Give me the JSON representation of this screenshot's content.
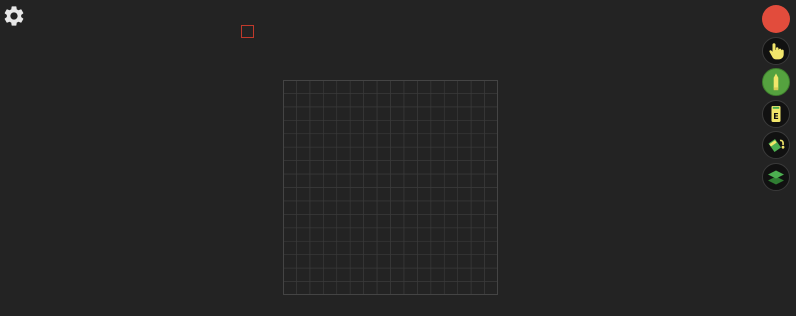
{
  "colors": {
    "background": "#232323",
    "grid_line": "#3a3a3a",
    "grid_border": "#444444",
    "selection_outline": "#c0392b",
    "current_color": "#e24c3c",
    "tool_bg": "#111111",
    "tool_active_bg": "#55a23f",
    "icon_fill": "#f2e66b",
    "icon_green": "#4caf50"
  },
  "grid": {
    "columns": 16,
    "rows": 16
  },
  "toolbar": {
    "tools": [
      {
        "name": "color-picker",
        "icon": "color-swatch",
        "active": false
      },
      {
        "name": "pointer-tool",
        "icon": "hand-pointer-icon",
        "active": false
      },
      {
        "name": "pencil-tool",
        "icon": "pencil-icon",
        "active": true
      },
      {
        "name": "eraser-tool",
        "icon": "eraser-icon",
        "active": false
      },
      {
        "name": "fill-tool",
        "icon": "paint-bucket-icon",
        "active": false
      },
      {
        "name": "layers-tool",
        "icon": "layers-icon",
        "active": false
      }
    ]
  }
}
